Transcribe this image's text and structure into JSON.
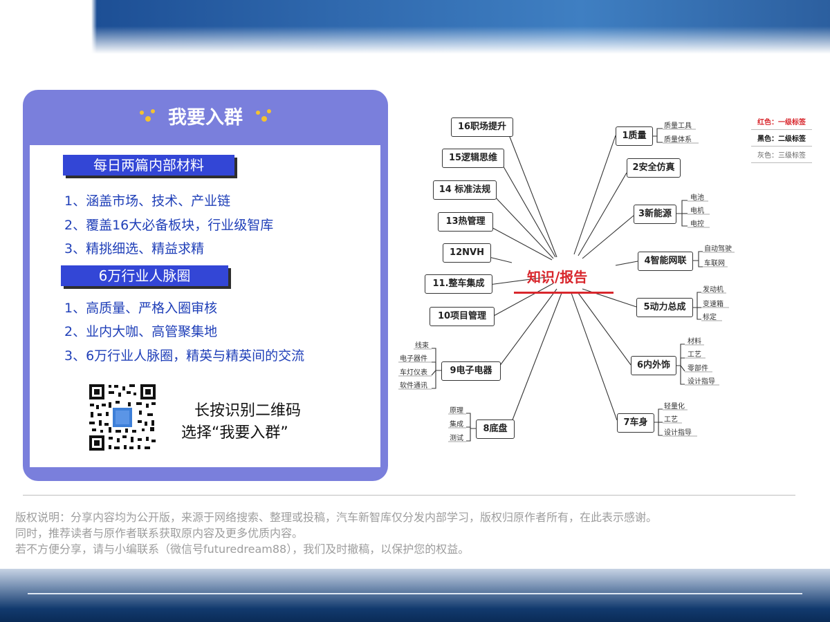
{
  "card": {
    "title": "我要入群",
    "section1": {
      "tag": "每日两篇内部材料",
      "items": [
        "1、涵盖市场、技术、产业链",
        "2、覆盖16大必备板块，行业级智库",
        "3、精挑细选、精益求精"
      ]
    },
    "section2": {
      "tag": "6万行业人脉圈",
      "items": [
        "1、高质量、严格入圈审核",
        "2、业内大咖、高管聚集地",
        "3、6万行业人脉圈，精英与精英间的交流"
      ]
    },
    "qr_caption_line1": "长按识别二维码",
    "qr_caption_line2": "选择“我要入群”"
  },
  "mindmap": {
    "center": "知识/报告",
    "left_nodes": [
      "16职场提升",
      "15逻辑思维",
      "14 标准法规",
      "13热管理",
      "12NVH",
      "11.整车集成",
      "10项目管理",
      "9电子电器",
      "8底盘"
    ],
    "right_nodes": [
      "1质量",
      "2安全仿真",
      "3新能源",
      "4智能网联",
      "5动力总成",
      "6内外饰",
      "7车身"
    ],
    "sub": {
      "quality": [
        "质量工具",
        "质量体系"
      ],
      "new_energy": [
        "电池",
        "电机",
        "电控"
      ],
      "smart": [
        "自动驾驶",
        "车联网"
      ],
      "powertrain": [
        "发动机",
        "变速箱",
        "标定"
      ],
      "interior": [
        "材料",
        "工艺",
        "零部件",
        "设计指导"
      ],
      "body": [
        "轻量化",
        "工艺",
        "设计指导"
      ],
      "electrical": [
        "线束",
        "电子器件",
        "车灯仪表",
        "软件通讯"
      ],
      "chassis": [
        "原理",
        "集成",
        "测试"
      ]
    },
    "legend": [
      "红色：一级标签",
      "黑色：二级标签",
      "灰色：三级标签"
    ]
  },
  "copyright": {
    "line1": "版权说明：分享内容均为公开版，来源于网络搜索、整理或投稿，汽车新智库仅分发内部学习，版权归原作者所有，在此表示感谢。",
    "line2": "同时，推荐读者与原作者联系获取原内容及更多优质内容。",
    "line3": "若不方便分享，请与小编联系（微信号futuredream88），我们及时撤稿，以保护您的权益。"
  },
  "colors": {
    "card": "#7a7fdc",
    "tag": "#3346d6",
    "list_text": "#1f3fb8",
    "center": "#d8262c",
    "legend_red": "#d8262c"
  }
}
